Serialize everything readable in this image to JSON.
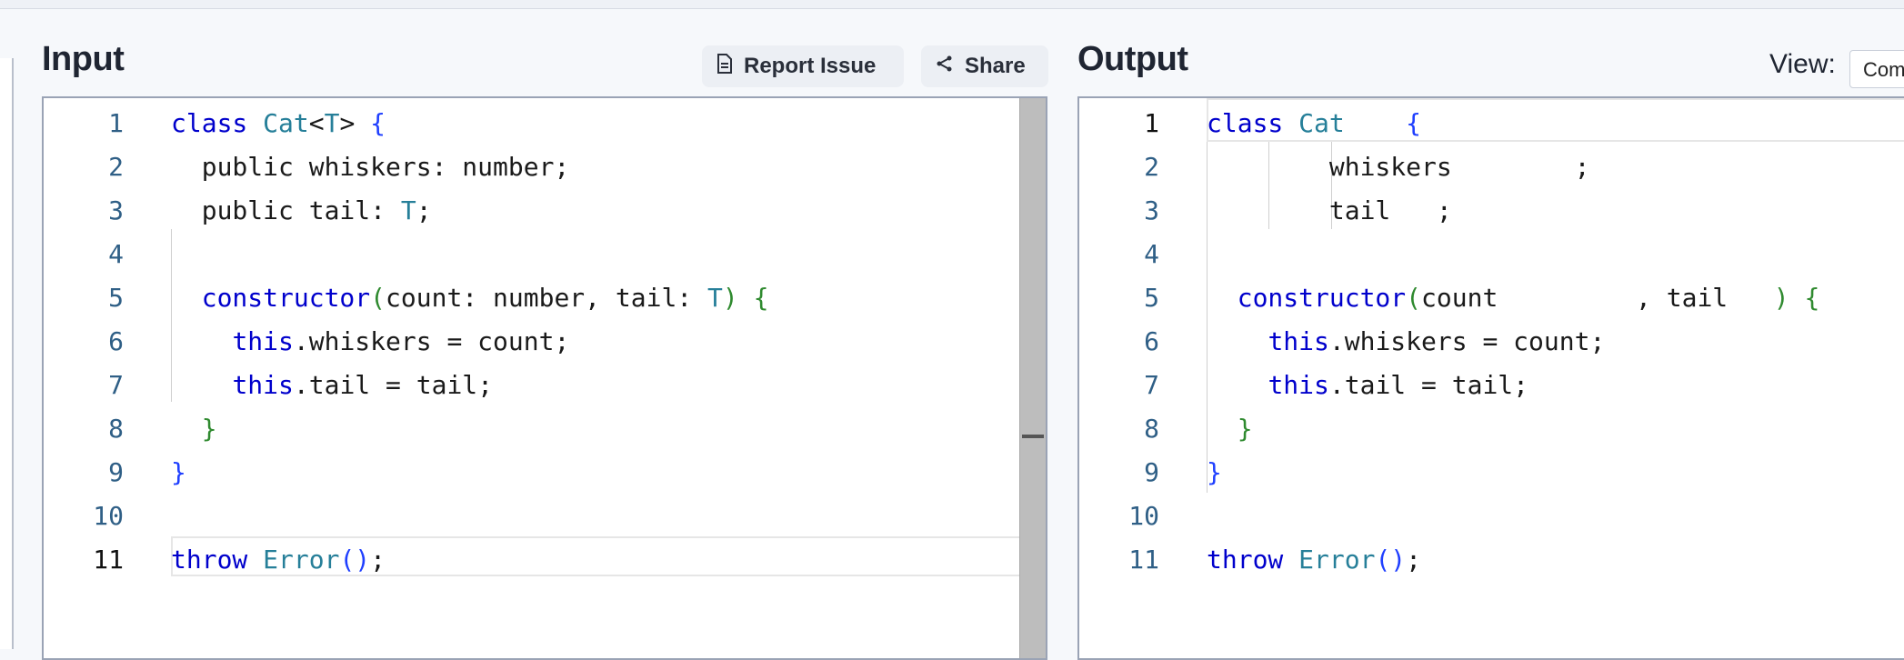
{
  "input": {
    "title": "Input",
    "report_label": "Report Issue",
    "share_label": "Share",
    "lines": [
      {
        "n": "1",
        "parts": [
          [
            "class",
            "k"
          ],
          [
            " "
          ],
          [
            "Cat",
            "t"
          ],
          [
            "<"
          ],
          [
            "T",
            "t"
          ],
          [
            "> "
          ],
          [
            "{",
            "b"
          ]
        ]
      },
      {
        "n": "2",
        "parts": [
          [
            "  public whiskers: number;"
          ]
        ]
      },
      {
        "n": "3",
        "parts": [
          [
            "  public tail: "
          ],
          [
            "T",
            "t"
          ],
          [
            ";"
          ]
        ]
      },
      {
        "n": "4",
        "parts": []
      },
      {
        "n": "5",
        "parts": [
          [
            "  "
          ],
          [
            "constructor",
            "k"
          ],
          [
            "(",
            "g"
          ],
          [
            "count: number, tail: "
          ],
          [
            "T",
            "t"
          ],
          [
            ")",
            "g"
          ],
          [
            " "
          ],
          [
            "{",
            "g"
          ]
        ]
      },
      {
        "n": "6",
        "parts": [
          [
            "    "
          ],
          [
            "this",
            "k"
          ],
          [
            ".whiskers = count;"
          ]
        ]
      },
      {
        "n": "7",
        "parts": [
          [
            "    "
          ],
          [
            "this",
            "k"
          ],
          [
            ".tail = tail;"
          ]
        ]
      },
      {
        "n": "8",
        "parts": [
          [
            "  "
          ],
          [
            "}",
            "g"
          ]
        ]
      },
      {
        "n": "9",
        "parts": [
          [
            "}",
            "b"
          ]
        ]
      },
      {
        "n": "10",
        "parts": []
      },
      {
        "n": "11",
        "parts": [
          [
            "throw",
            "k"
          ],
          [
            " "
          ],
          [
            "Error",
            "t"
          ],
          [
            "()",
            "b"
          ],
          [
            ";"
          ]
        ]
      }
    ]
  },
  "output": {
    "title": "Output",
    "view_label": "View:",
    "view_value": "Compiled",
    "lines": [
      {
        "n": "1",
        "parts": [
          [
            "class",
            "k"
          ],
          [
            " "
          ],
          [
            "Cat",
            "t"
          ],
          [
            "    "
          ],
          [
            "{",
            "b"
          ]
        ]
      },
      {
        "n": "2",
        "parts": [
          [
            "        whiskers        ;"
          ]
        ]
      },
      {
        "n": "3",
        "parts": [
          [
            "        tail   ;"
          ]
        ]
      },
      {
        "n": "4",
        "parts": []
      },
      {
        "n": "5",
        "parts": [
          [
            "  "
          ],
          [
            "constructor",
            "k"
          ],
          [
            "(",
            "g"
          ],
          [
            "count         , tail   "
          ],
          [
            ")",
            "g"
          ],
          [
            " "
          ],
          [
            "{",
            "g"
          ]
        ]
      },
      {
        "n": "6",
        "parts": [
          [
            "    "
          ],
          [
            "this",
            "k"
          ],
          [
            ".whiskers = count;"
          ]
        ]
      },
      {
        "n": "7",
        "parts": [
          [
            "    "
          ],
          [
            "this",
            "k"
          ],
          [
            ".tail = tail;"
          ]
        ]
      },
      {
        "n": "8",
        "parts": [
          [
            "  "
          ],
          [
            "}",
            "g"
          ]
        ]
      },
      {
        "n": "9",
        "parts": [
          [
            "}",
            "b"
          ]
        ]
      },
      {
        "n": "10",
        "parts": []
      },
      {
        "n": "11",
        "parts": [
          [
            "throw",
            "k"
          ],
          [
            " "
          ],
          [
            "Error",
            "t"
          ],
          [
            "()",
            "b"
          ],
          [
            ";"
          ]
        ]
      }
    ]
  },
  "colors": {
    "keyword": "#0000cc",
    "type": "#267f99",
    "bracket_green": "#2f8a2f",
    "bracket_blue": "#1f3fff",
    "line_number": "#2f5f86"
  },
  "active_line": {
    "input": "11",
    "output": "1"
  }
}
